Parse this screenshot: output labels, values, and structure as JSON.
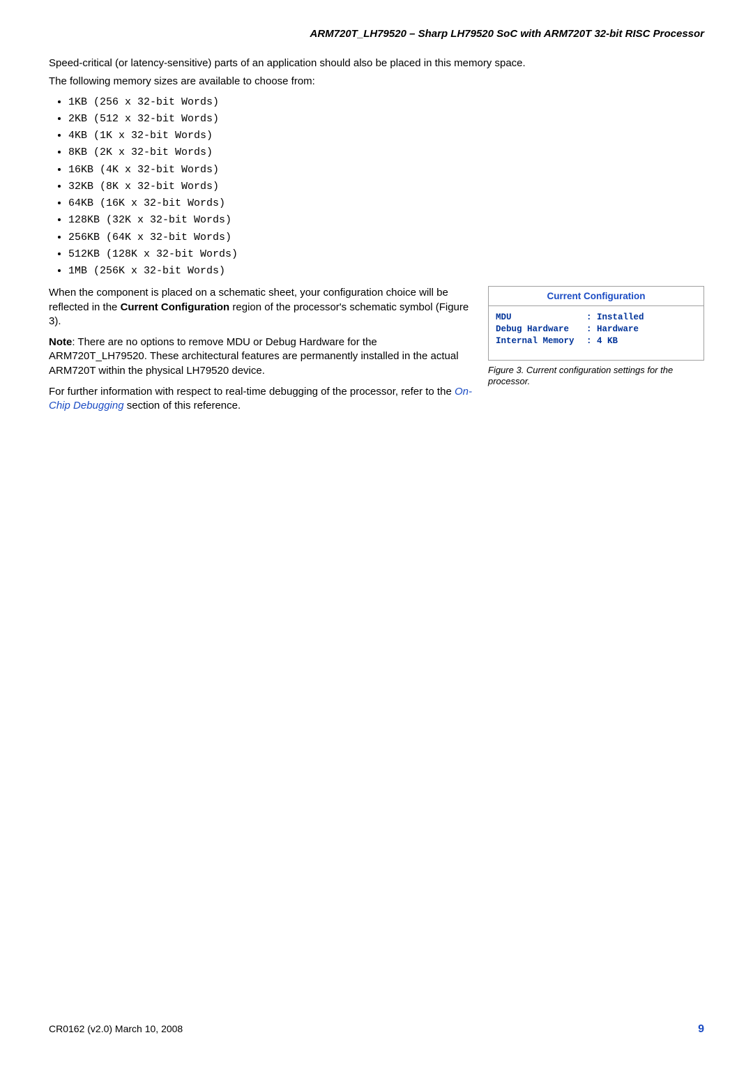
{
  "header": {
    "title": "ARM720T_LH79520 – Sharp LH79520 SoC with ARM720T 32-bit RISC Processor"
  },
  "intro": {
    "p1": "Speed-critical (or latency-sensitive) parts of an application should also be placed in this memory space.",
    "p2": "The following memory sizes are available to choose from:"
  },
  "memory_sizes": [
    "1KB (256 x 32-bit Words)",
    "2KB (512 x 32-bit Words)",
    "4KB (1K x 32-bit Words)",
    "8KB (2K x 32-bit Words)",
    "16KB (4K x 32-bit Words)",
    "32KB (8K x 32-bit Words)",
    "64KB (16K x 32-bit Words)",
    "128KB (32K x 32-bit Words)",
    "256KB (64K x 32-bit Words)",
    "512KB (128K x 32-bit Words)",
    "1MB (256K x 32-bit Words)"
  ],
  "paragraphs": {
    "p3a": "When the component is placed on a schematic sheet, your configuration choice will be reflected in the ",
    "p3b": "Current Configuration",
    "p3c": " region of the processor's schematic symbol (Figure 3).",
    "p4a": "Note",
    "p4b": ": There are no options to remove MDU or Debug Hardware for the ARM720T_LH79520. These architectural features are permanently installed in the actual ARM720T within the physical LH79520 device.",
    "p5a": "For further information with respect to real-time debugging of the processor, refer to the ",
    "p5link": "On-Chip Debugging",
    "p5b": " section of this reference."
  },
  "config_box": {
    "header": "Current Configuration",
    "rows": [
      {
        "label": "MDU",
        "value": ": Installed"
      },
      {
        "label": "Debug Hardware",
        "value": ": Hardware"
      },
      {
        "label": "Internal Memory",
        "value": ": 4 KB"
      }
    ]
  },
  "caption": "Figure 3. Current configuration settings for the processor.",
  "footer": {
    "left": "CR0162 (v2.0) March 10, 2008",
    "right": "9"
  }
}
